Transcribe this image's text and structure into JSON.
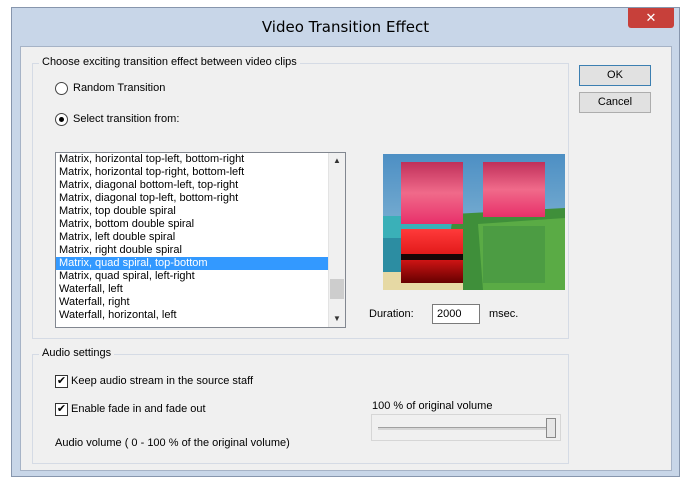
{
  "window": {
    "title": "Video Transition Effect",
    "close_glyph": "✕"
  },
  "transition_group": {
    "legend": "Choose exciting transition effect between video clips",
    "random_label": "Random Transition",
    "select_label": "Select transition from:",
    "selected_mode": "select",
    "items": [
      "Matrix, horizontal top-left, bottom-right",
      "Matrix, horizontal top-right, bottom-left",
      "Matrix, diagonal bottom-left, top-right",
      "Matrix, diagonal top-left, bottom-right",
      "Matrix, top double spiral",
      "Matrix, bottom double spiral",
      "Matrix, left double spiral",
      "Matrix, right double spiral",
      "Matrix, quad spiral, top-bottom",
      "Matrix, quad spiral, left-right",
      "Waterfall, left",
      "Waterfall, right",
      "Waterfall, horizontal, left"
    ],
    "selected_index": 8,
    "duration_label": "Duration:",
    "duration_value": "2000",
    "duration_unit": "msec."
  },
  "buttons": {
    "ok": "OK",
    "cancel": "Cancel"
  },
  "audio_group": {
    "legend": "Audio settings",
    "keep_audio_label": "Keep audio stream in the source staff",
    "keep_audio_checked": true,
    "fade_label": "Enable fade in and fade out",
    "fade_checked": true,
    "volume_label": "Audio volume ( 0 - 100 % of the original volume)",
    "volume_readout": "100 % of original volume",
    "volume_percent": 100
  },
  "colors": {
    "window_frame": "#c8d6e8",
    "close_button": "#c7403a",
    "selection": "#3399ff"
  }
}
